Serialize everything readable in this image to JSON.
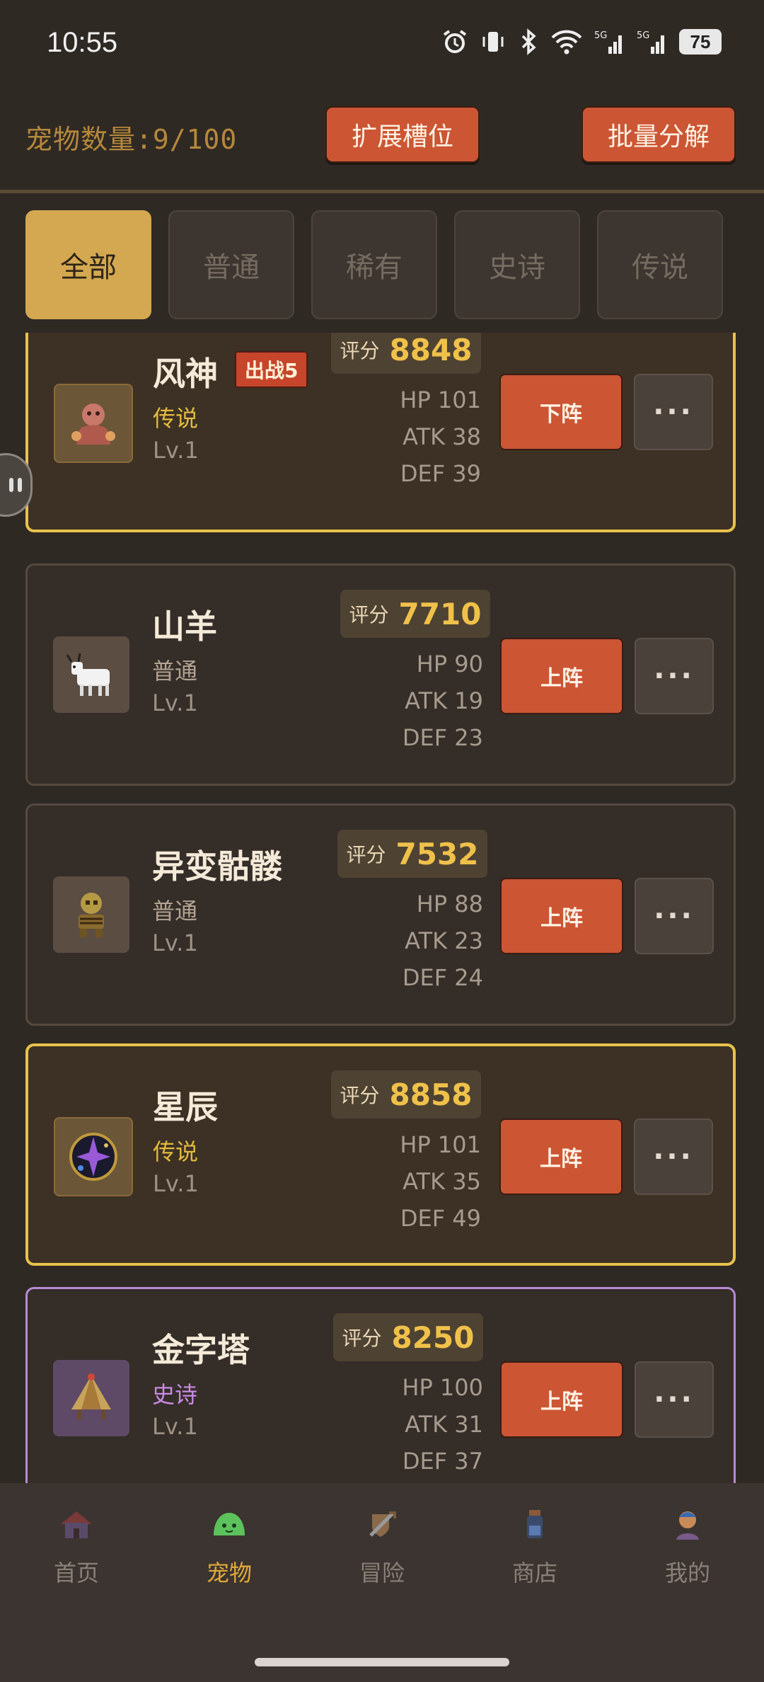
{
  "status_bar": {
    "time": "10:55",
    "battery": "75"
  },
  "header": {
    "pet_count_label": "宠物数量:",
    "pet_count_value": "9/100",
    "expand_slots": "扩展槽位",
    "batch_decompose": "批量分解"
  },
  "filters": [
    "全部",
    "普通",
    "稀有",
    "史诗",
    "传说"
  ],
  "active_filter": "全部",
  "score_label": "评分",
  "pets": [
    {
      "name": "风神",
      "rarity": "传说",
      "level": "Lv.1",
      "score": "8848",
      "hp": "HP 101",
      "atk": "ATK 38",
      "def": "DEF 39",
      "action": "下阵",
      "badge": "出战5",
      "more": "···"
    },
    {
      "name": "山羊",
      "rarity": "普通",
      "level": "Lv.1",
      "score": "7710",
      "hp": "HP 90",
      "atk": "ATK 19",
      "def": "DEF 23",
      "action": "上阵",
      "more": "···"
    },
    {
      "name": "异变骷髅",
      "rarity": "普通",
      "level": "Lv.1",
      "score": "7532",
      "hp": "HP 88",
      "atk": "ATK 23",
      "def": "DEF 24",
      "action": "上阵",
      "more": "···"
    },
    {
      "name": "星辰",
      "rarity": "传说",
      "level": "Lv.1",
      "score": "8858",
      "hp": "HP 101",
      "atk": "ATK 35",
      "def": "DEF 49",
      "action": "上阵",
      "more": "···"
    },
    {
      "name": "金字塔",
      "rarity": "史诗",
      "level": "Lv.1",
      "score": "8250",
      "hp": "HP 100",
      "atk": "ATK 31",
      "def": "DEF 37",
      "action": "上阵",
      "more": "···"
    }
  ],
  "bottom_nav": [
    {
      "label": "首页",
      "icon": "house-icon"
    },
    {
      "label": "宠物",
      "icon": "slime-icon",
      "active": true
    },
    {
      "label": "冒险",
      "icon": "sword-shield-icon"
    },
    {
      "label": "商店",
      "icon": "potion-icon"
    },
    {
      "label": "我的",
      "icon": "profile-icon"
    }
  ],
  "colors": {
    "accent": "#cc5634",
    "gold": "#e8c24c",
    "epic": "#c98ae6",
    "background": "#2f2924"
  }
}
